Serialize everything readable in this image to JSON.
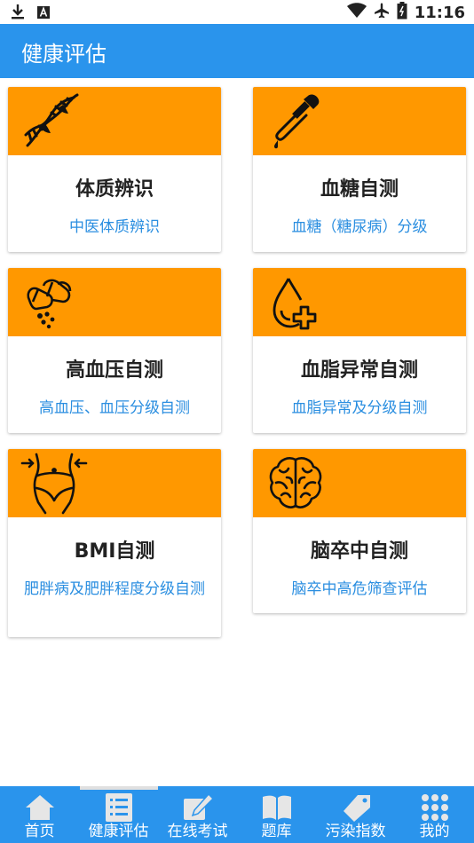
{
  "status": {
    "time": "11:16"
  },
  "appbar": {
    "title": "健康评估"
  },
  "cards": [
    {
      "title": "体质辨识",
      "subtitle": "中医体质辨识",
      "icon": "dna-icon"
    },
    {
      "title": "血糖自测",
      "subtitle": "血糖（糖尿病）分级",
      "icon": "dropper-icon"
    },
    {
      "title": "高血压自测",
      "subtitle": "高血压、血压分级自测",
      "icon": "pills-icon"
    },
    {
      "title": "血脂异常自测",
      "subtitle": "血脂异常及分级自测",
      "icon": "blood-drop-plus-icon"
    },
    {
      "title": "BMI自测",
      "subtitle": "肥胖病及肥胖程度分级自测",
      "icon": "waist-icon"
    },
    {
      "title": "脑卒中自测",
      "subtitle": "脑卒中高危筛查评估",
      "icon": "brain-icon"
    }
  ],
  "nav": [
    {
      "label": "首页",
      "icon": "home-icon"
    },
    {
      "label": "健康评估",
      "icon": "checklist-icon",
      "active": true
    },
    {
      "label": "在线考试",
      "icon": "edit-icon"
    },
    {
      "label": "题库",
      "icon": "book-icon"
    },
    {
      "label": "污染指数",
      "icon": "tag-icon"
    },
    {
      "label": "我的",
      "icon": "grid-icon"
    }
  ],
  "colors": {
    "primary": "#2a94ec",
    "banner": "#ff9800",
    "link": "#2a8ee0"
  }
}
